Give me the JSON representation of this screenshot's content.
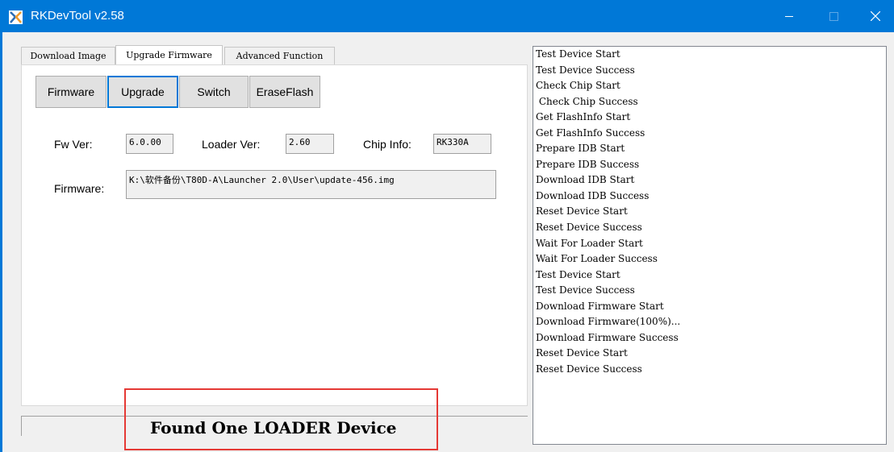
{
  "window": {
    "title": "RKDevTool v2.58"
  },
  "tabs": [
    {
      "label": "Download Image"
    },
    {
      "label": "Upgrade Firmware",
      "active": true
    },
    {
      "label": "Advanced Function"
    }
  ],
  "buttons": {
    "firmware": "Firmware",
    "upgrade": "Upgrade",
    "switch": "Switch",
    "erase_flash": "EraseFlash"
  },
  "info": {
    "fw_ver_label": "Fw Ver:",
    "fw_ver_value": "6.0.00",
    "loader_ver_label": "Loader Ver:",
    "loader_ver_value": "2.60",
    "chip_info_label": "Chip Info:",
    "chip_info_value": "RK330A",
    "firmware_label": "Firmware:",
    "firmware_path": "K:\\软件备份\\T80D-A\\Launcher 2.0\\User\\update-456.img"
  },
  "log": [
    "Test Device Start",
    "Test Device Success",
    "Check Chip Start",
    " Check Chip Success",
    "Get FlashInfo Start",
    "Get FlashInfo Success",
    "Prepare IDB Start",
    "Prepare IDB Success",
    "Download IDB Start",
    "Download IDB Success",
    "Reset Device Start",
    "Reset Device Success",
    "Wait For Loader Start",
    "Wait For Loader Success",
    "Test Device Start",
    "Test Device Success",
    "Download Firmware Start",
    "Download Firmware(100%)...",
    "Download Firmware Success",
    "Reset Device Start",
    "Reset Device Success"
  ],
  "status": {
    "text": "Found One LOADER Device"
  },
  "colors": {
    "titlebar": "#0078d7",
    "highlight": "#e53935",
    "active_button_border": "#0078d7"
  }
}
